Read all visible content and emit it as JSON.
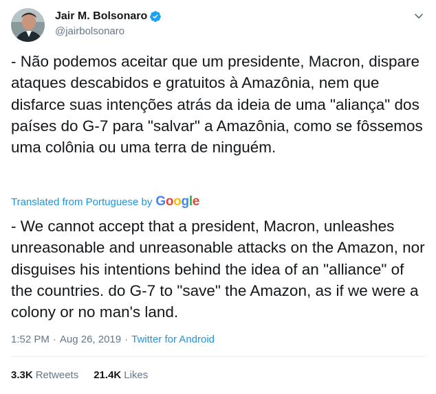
{
  "author": {
    "display_name": "Jair M. Bolsonaro",
    "handle": "@jairbolsonaro",
    "verified": true
  },
  "icons": {
    "verified": "verified-badge-icon",
    "menu": "chevron-down-icon"
  },
  "tweet": {
    "original_text": "- Não podemos aceitar que um presidente, Macron, dispare ataques descabidos e gratuitos à Amazônia, nem que disfarce suas intenções atrás da ideia de uma \"aliança\" dos países do G-7 para \"salvar\" a Amazônia, como se fôssemos uma colônia ou uma terra de ninguém.",
    "translated_from_label": "Translated from Portuguese by",
    "translator_brand": "Google",
    "translated_text": "- We cannot accept that a president, Macron, unleashes unreasonable and unreasonable attacks on the Amazon, nor disguises his intentions behind the idea of an \"alliance\" of the countries. do G-7 to \"save\" the Amazon, as if we were a colony or no man's land.",
    "time": "1:52 PM",
    "separator": "·",
    "date": "Aug 26, 2019",
    "source": "Twitter for Android"
  },
  "stats": {
    "retweets_count": "3.3K",
    "retweets_label": "Retweets",
    "likes_count": "21.4K",
    "likes_label": "Likes"
  },
  "colors": {
    "link_blue": "#1b95e0",
    "text": "#14171a",
    "muted": "#657786",
    "divider": "#e6ecf0"
  }
}
